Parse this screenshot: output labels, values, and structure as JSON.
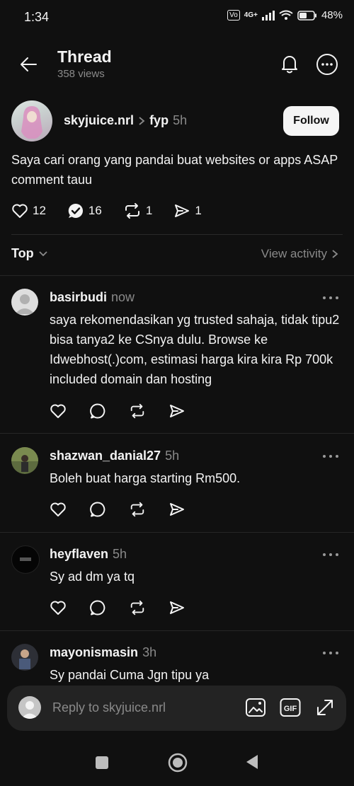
{
  "status_bar": {
    "time": "1:34",
    "network": "4G+",
    "battery": "48%"
  },
  "header": {
    "title": "Thread",
    "views": "358 views"
  },
  "post": {
    "author": "skyjuice.nrl",
    "topic": "fyp",
    "time": "5h",
    "follow_label": "Follow",
    "text": "Saya cari orang yang pandai buat websites or apps ASAP comment tauu",
    "likes": "12",
    "replies": "16",
    "reposts": "1",
    "shares": "1"
  },
  "sort": {
    "label": "Top",
    "view_activity": "View activity"
  },
  "comments": [
    {
      "username": "basirbudi",
      "time": "now",
      "text": "saya rekomendasikan yg trusted sahaja, tidak tipu2 bisa tanya2 ke CSnya dulu. Browse ke Idwebhost(.)com, estimasi harga kira kira Rp 700k included domain dan hosting"
    },
    {
      "username": "shazwan_danial27",
      "time": "5h",
      "text": "Boleh buat harga starting Rm500."
    },
    {
      "username": "heyflaven",
      "time": "5h",
      "text": "Sy ad dm ya tq"
    },
    {
      "username": "mayonismasin",
      "time": "3h",
      "text": "Sy pandai Cuma Jgn tipu ya"
    }
  ],
  "reply": {
    "placeholder": "Reply to skyjuice.nrl"
  },
  "colors": {
    "background": "#101010",
    "text": "#f3f3f3",
    "muted": "#8a8a8a",
    "follow_bg": "#f5f5f5"
  }
}
